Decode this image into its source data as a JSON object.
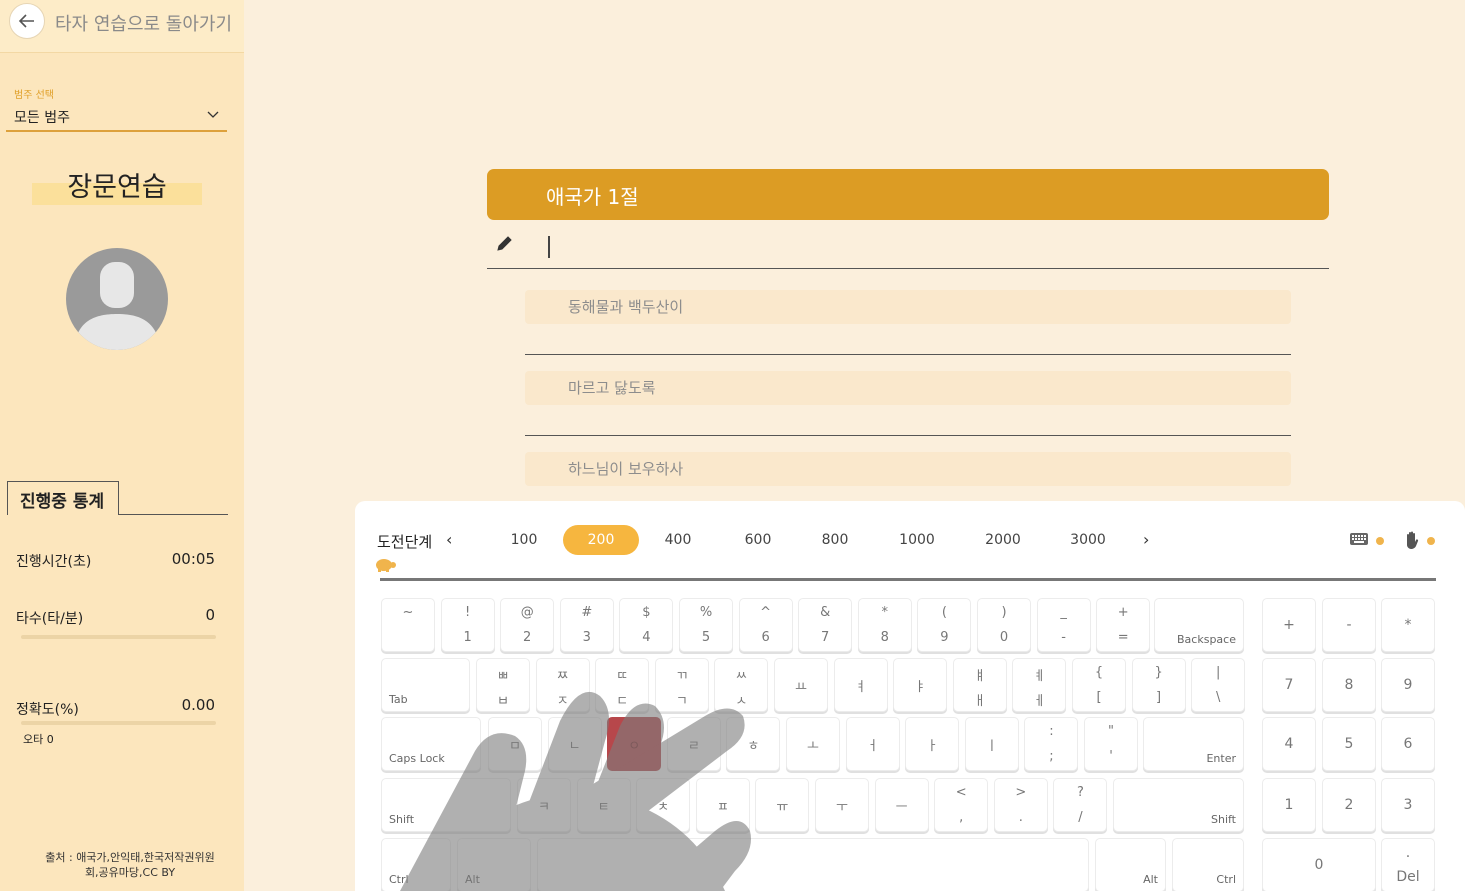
{
  "sidebar": {
    "back_label": "타자 연습으로 돌아가기",
    "category_label": "범주 선택",
    "category_value": "모든 범주",
    "mode_title": "장문연습",
    "stats_tab": "진행중 통계",
    "stats": {
      "time_label": "진행시간(초)",
      "time_value": "00:05",
      "speed_label": "타수(타/분)",
      "speed_value": "0",
      "accuracy_label": "정확도(%)",
      "accuracy_value": "0.00",
      "typo_label": "오타 0"
    },
    "source_line1": "출처 : 애국가,안익태,한국저작권위원",
    "source_line2": "회,공유마당,CC BY"
  },
  "practice": {
    "title": "애국가 1절",
    "input_value": "",
    "next_lines": [
      "동해물과 백두산이",
      "마르고 닳도록",
      "하느님이 보우하사"
    ]
  },
  "levels": {
    "label": "도전단계",
    "prev": "‹",
    "next": "›",
    "items": [
      "100",
      "200",
      "400",
      "600",
      "800",
      "1000",
      "2000",
      "3000"
    ],
    "active": "200"
  },
  "colors": {
    "accent": "#dc9c24",
    "active_level": "#f6b63f",
    "highlight_key": "#b7474b",
    "sidebar_bg": "#fce6bd",
    "page_bg": "#fbefdc"
  },
  "icons": [
    "back-arrow-icon",
    "chevron-down-icon",
    "pencil-icon",
    "turtle-icon",
    "keyboard-icon",
    "hand-icon"
  ],
  "keyboard": {
    "row1": [
      {
        "t": "~",
        "b": ""
      },
      {
        "t": "!",
        "b": "1"
      },
      {
        "t": "@",
        "b": "2"
      },
      {
        "t": "#",
        "b": "3"
      },
      {
        "t": "$",
        "b": "4"
      },
      {
        "t": "%",
        "b": "5"
      },
      {
        "t": "^",
        "b": "6"
      },
      {
        "t": "&",
        "b": "7"
      },
      {
        "t": "*",
        "b": "8"
      },
      {
        "t": "(",
        "b": "9"
      },
      {
        "t": ")",
        "b": "0"
      },
      {
        "t": "_",
        "b": "-"
      },
      {
        "t": "+",
        "b": "="
      }
    ],
    "backspace": "Backspace",
    "tab": "Tab",
    "row2": [
      {
        "t": "ㅃ",
        "b": "ㅂ"
      },
      {
        "t": "ㅉ",
        "b": "ㅈ"
      },
      {
        "t": "ㄸ",
        "b": "ㄷ"
      },
      {
        "t": "ㄲ",
        "b": "ㄱ"
      },
      {
        "t": "ㅆ",
        "b": "ㅅ"
      },
      {
        "t": "",
        "b": "",
        "c": "ㅛ"
      },
      {
        "t": "",
        "b": "",
        "c": "ㅕ"
      },
      {
        "t": "",
        "b": "",
        "c": "ㅑ"
      },
      {
        "t": "ㅒ",
        "b": "ㅐ"
      },
      {
        "t": "ㅖ",
        "b": "ㅔ"
      },
      {
        "t": "{",
        "b": "["
      },
      {
        "t": "}",
        "b": "]"
      },
      {
        "t": "|",
        "b": "\\"
      }
    ],
    "capslock": "Caps Lock",
    "row3": [
      {
        "c": "ㅁ"
      },
      {
        "c": "ㄴ"
      },
      {
        "c": "ㅇ"
      },
      {
        "c": "ㄹ"
      },
      {
        "c": "ㅎ"
      },
      {
        "c": "ㅗ"
      },
      {
        "c": "ㅓ"
      },
      {
        "c": "ㅏ"
      },
      {
        "c": "ㅣ"
      },
      {
        "t": ":",
        "b": ";"
      },
      {
        "t": "\"",
        "b": "'"
      }
    ],
    "enter": "Enter",
    "shift_left": "Shift",
    "row4": [
      {
        "c": "ㅋ"
      },
      {
        "c": "ㅌ"
      },
      {
        "c": "ㅊ"
      },
      {
        "c": "ㅍ"
      },
      {
        "c": "ㅠ"
      },
      {
        "c": "ㅜ"
      },
      {
        "c": "ㅡ"
      },
      {
        "t": "<",
        "b": ","
      },
      {
        "t": ">",
        "b": "."
      },
      {
        "t": "?",
        "b": "/"
      }
    ],
    "shift_right": "Shift",
    "ctrl_left": "Ctrl",
    "alt_left": "Alt",
    "alt_right": "Alt",
    "ctrl_right": "Ctrl",
    "highlighted_key": "ㅇ",
    "numpad": {
      "row0": [
        "+",
        "-",
        "*"
      ],
      "row1": [
        "7",
        "8",
        "9"
      ],
      "row2": [
        "4",
        "5",
        "6"
      ],
      "row3": [
        "1",
        "2",
        "3"
      ],
      "zero": "0",
      "del_top": ".",
      "del_bottom": "Del"
    }
  }
}
